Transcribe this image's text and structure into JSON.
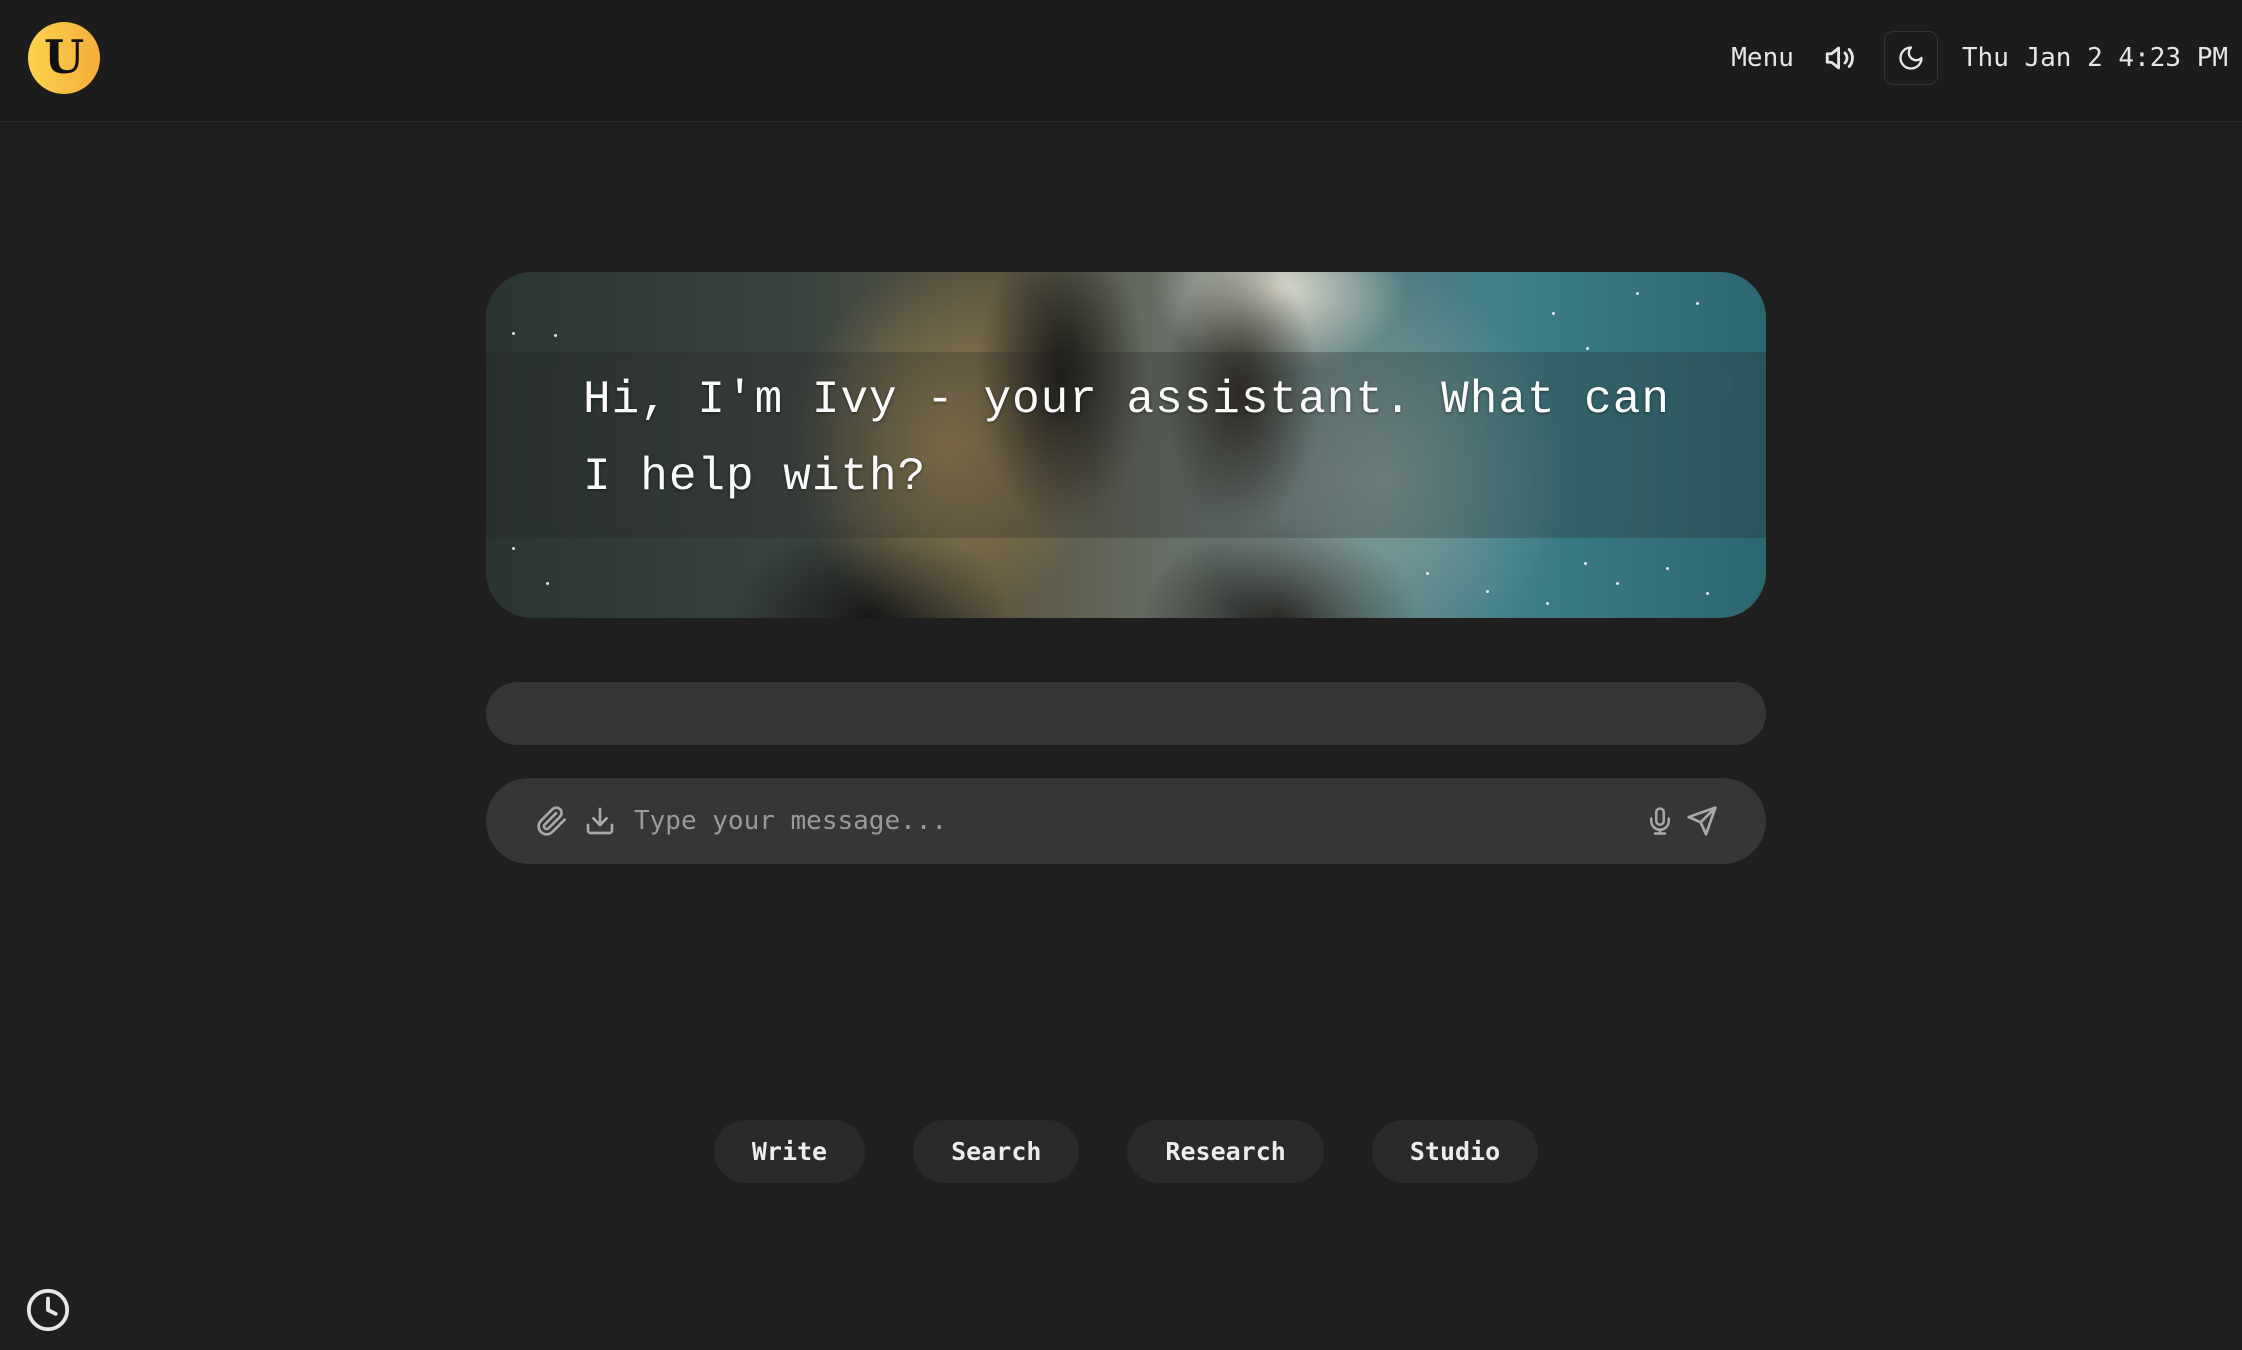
{
  "header": {
    "logo_letter": "U",
    "menu_label": "Menu",
    "sound_icon": "speaker-volume-icon",
    "theme_icon": "moon-icon",
    "datetime": "Thu Jan 2 4:23 PM"
  },
  "hero": {
    "greeting": "Hi, I'm Ivy - your assistant. What can I help with?",
    "background": "space-nebula-image"
  },
  "composer": {
    "placeholder": "Type your message...",
    "value": "",
    "left_icons": [
      "paperclip-icon",
      "download-icon"
    ],
    "right_icons": [
      "microphone-icon",
      "send-icon"
    ]
  },
  "suggestions": [
    {
      "label": "Write"
    },
    {
      "label": "Search"
    },
    {
      "label": "Research"
    },
    {
      "label": "Studio"
    }
  ],
  "footer": {
    "history_icon": "clock-icon"
  },
  "colors": {
    "background": "#1f1f1f",
    "header": "#1c1c1c",
    "input": "#363636",
    "chip": "#2a2a2a",
    "logo_gradient_start": "#fbd34d",
    "logo_gradient_end": "#f5ae3a"
  }
}
